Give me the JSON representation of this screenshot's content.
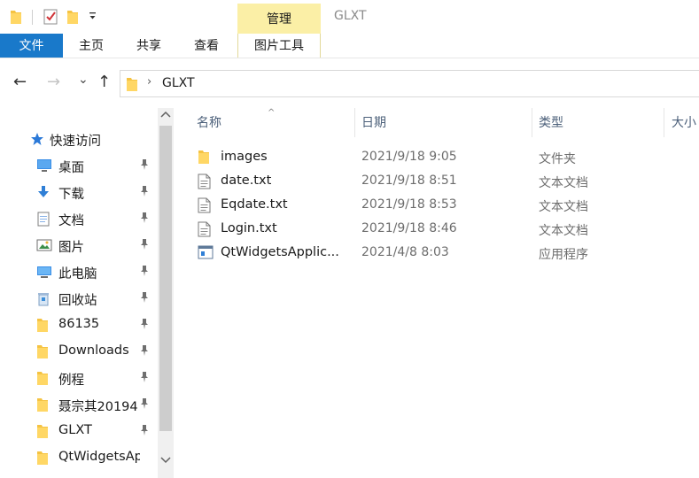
{
  "window": {
    "title": "GLXT"
  },
  "quick_access_toolbar": {
    "icons": [
      "folder-icon",
      "properties-check-icon",
      "new-folder-icon",
      "customize-dropdown-icon"
    ]
  },
  "ribbon": {
    "contextual_group": "管理",
    "tabs": [
      {
        "label": "文件",
        "active": true
      },
      {
        "label": "主页"
      },
      {
        "label": "共享"
      },
      {
        "label": "查看"
      },
      {
        "label": "图片工具"
      }
    ]
  },
  "navigation": {
    "back": "←",
    "forward": "→",
    "recent": "⌄",
    "up": "↑",
    "address": {
      "chevron": "›",
      "path": "GLXT"
    }
  },
  "sidebar": {
    "quick_access": "快速访问",
    "items": [
      {
        "label": "桌面",
        "icon": "desktop-icon",
        "pinned": true
      },
      {
        "label": "下载",
        "icon": "download-icon",
        "pinned": true
      },
      {
        "label": "文档",
        "icon": "document-icon",
        "pinned": true
      },
      {
        "label": "图片",
        "icon": "picture-icon",
        "pinned": true
      },
      {
        "label": "此电脑",
        "icon": "computer-icon",
        "pinned": true
      },
      {
        "label": "回收站",
        "icon": "recycle-bin-icon",
        "pinned": true
      },
      {
        "label": "86135",
        "icon": "folder-icon",
        "pinned": true
      },
      {
        "label": "Downloads",
        "icon": "folder-icon",
        "pinned": true
      },
      {
        "label": "例程",
        "icon": "folder-icon",
        "pinned": true
      },
      {
        "label": "聂宗其20194",
        "icon": "folder-icon",
        "pinned": true
      },
      {
        "label": "GLXT",
        "icon": "folder-icon",
        "pinned": true
      },
      {
        "label": "QtWidgetsApp",
        "icon": "folder-icon",
        "pinned": false
      }
    ]
  },
  "file_list": {
    "columns": [
      "名称",
      "日期",
      "类型",
      "大小"
    ],
    "sort_indicator": "^",
    "rows": [
      {
        "name": "images",
        "date": "2021/9/18 9:05",
        "type": "文件夹",
        "icon": "folder-icon"
      },
      {
        "name": "date.txt",
        "date": "2021/9/18 8:51",
        "type": "文本文档",
        "icon": "text-file-icon"
      },
      {
        "name": "Eqdate.txt",
        "date": "2021/9/18 8:53",
        "type": "文本文档",
        "icon": "text-file-icon"
      },
      {
        "name": "Login.txt",
        "date": "2021/9/18 8:46",
        "type": "文本文档",
        "icon": "text-file-icon"
      },
      {
        "name": "QtWidgetsApplic...",
        "date": "2021/4/8 8:03",
        "type": "应用程序",
        "icon": "application-icon"
      }
    ]
  },
  "colors": {
    "file_tab": "#1979ca",
    "manage_tab": "#fbefa6",
    "folder": "#f5c342",
    "column_header_text": "#4c607a"
  }
}
